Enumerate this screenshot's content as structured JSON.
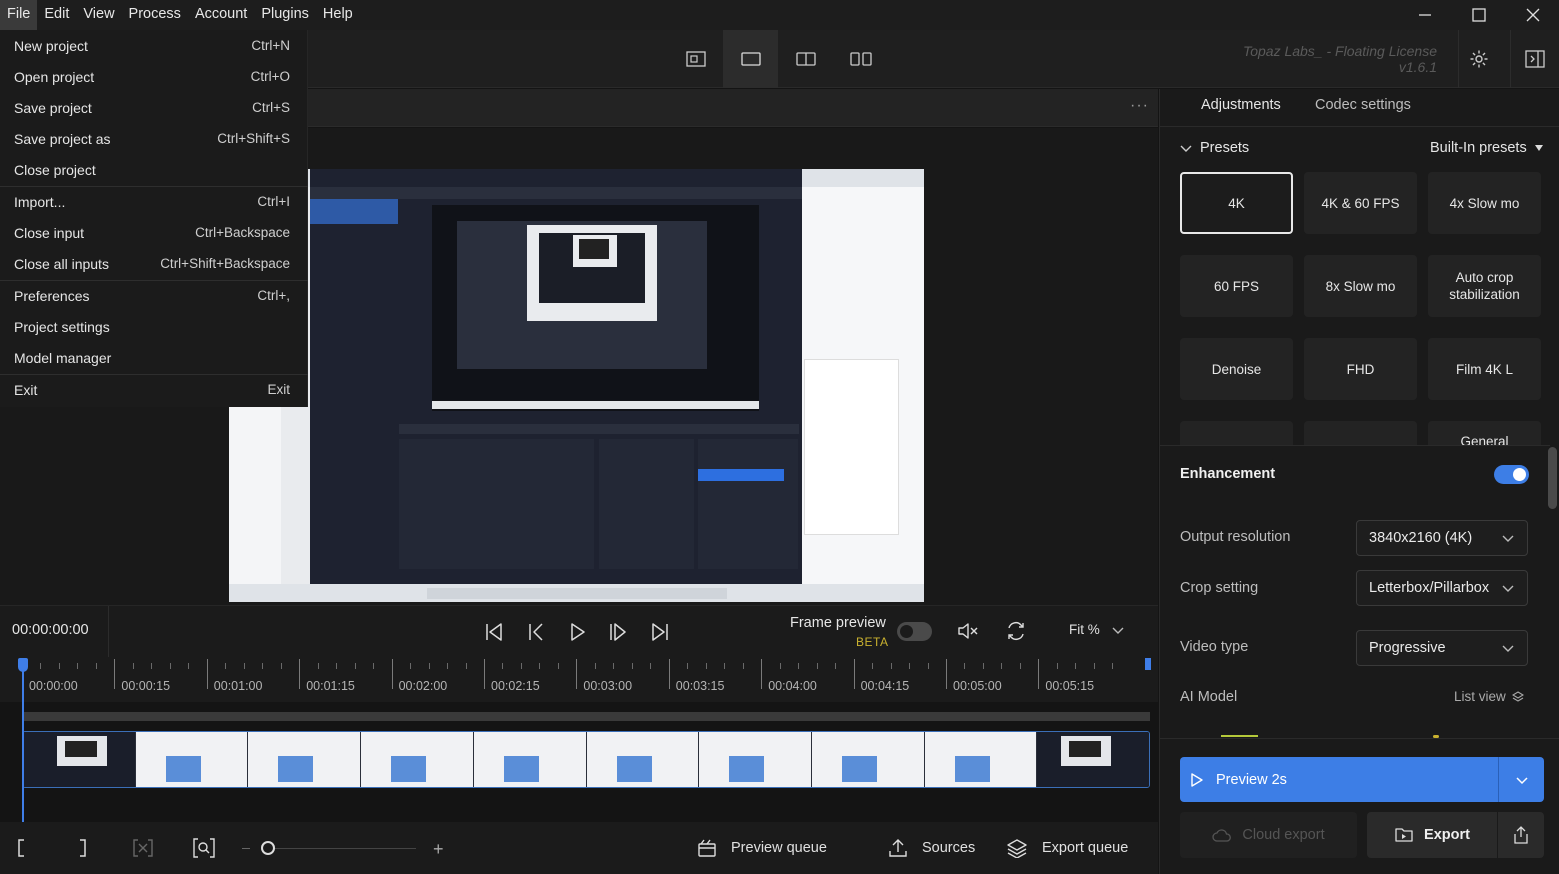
{
  "menubar": {
    "items": [
      "File",
      "Edit",
      "View",
      "Process",
      "Account",
      "Plugins",
      "Help"
    ]
  },
  "file_menu": {
    "items": [
      {
        "label": "New project",
        "shortcut": "Ctrl+N"
      },
      {
        "label": "Open project",
        "shortcut": "Ctrl+O"
      },
      {
        "label": "Save project",
        "shortcut": "Ctrl+S"
      },
      {
        "label": "Save project as",
        "shortcut": "Ctrl+Shift+S"
      },
      {
        "label": "Close project",
        "shortcut": ""
      },
      {
        "label": "Import...",
        "shortcut": "Ctrl+I"
      },
      {
        "label": "Close input",
        "shortcut": "Ctrl+Backspace"
      },
      {
        "label": "Close all inputs",
        "shortcut": "Ctrl+Shift+Backspace"
      },
      {
        "label": "Preferences",
        "shortcut": "Ctrl+,"
      },
      {
        "label": "Project settings",
        "shortcut": ""
      },
      {
        "label": "Model manager",
        "shortcut": ""
      },
      {
        "label": "Exit",
        "shortcut": "Exit"
      }
    ]
  },
  "license": {
    "line1": "Topaz Labs_ - Floating License",
    "version": "v1.6.1"
  },
  "transport": {
    "timecode": "00:00:00:00",
    "frame_preview_label": "Frame preview",
    "beta_label": "BETA",
    "frame_preview_enabled": false,
    "zoom_label": "Fit %"
  },
  "timeline": {
    "labels": [
      "00:00:00",
      "00:00:15",
      "00:01:00",
      "00:01:15",
      "00:02:00",
      "00:02:15",
      "00:03:00",
      "00:03:15",
      "00:04:00",
      "00:04:15",
      "00:05:00",
      "00:05:15"
    ]
  },
  "bottombar": {
    "preview_queue": "Preview queue",
    "sources": "Sources",
    "export_queue": "Export queue"
  },
  "right_panel": {
    "tabs": [
      "Adjustments",
      "Codec settings"
    ],
    "presets_title": "Presets",
    "presets_source": "Built-In presets",
    "presets": [
      "4K",
      "4K & 60 FPS",
      "4x Slow mo",
      "60 FPS",
      "8x Slow mo",
      "Auto crop stabilization",
      "Denoise",
      "FHD",
      "Film 4K L",
      "",
      "",
      "General"
    ],
    "selected_preset": "4K",
    "enhancement_title": "Enhancement",
    "enhancement_enabled": true,
    "output_resolution_label": "Output resolution",
    "output_resolution_value": "3840x2160 (4K)",
    "crop_setting_label": "Crop setting",
    "crop_setting_value": "Letterbox/Pillarbox",
    "video_type_label": "Video type",
    "video_type_value": "Progressive",
    "ai_model_label": "AI Model",
    "list_view_label": "List view",
    "preview_button": "Preview 2s",
    "cloud_export": "Cloud export",
    "export": "Export"
  },
  "colors": {
    "accent": "#3d7ee6",
    "background": "#141414",
    "panel": "#1a1a1a"
  }
}
